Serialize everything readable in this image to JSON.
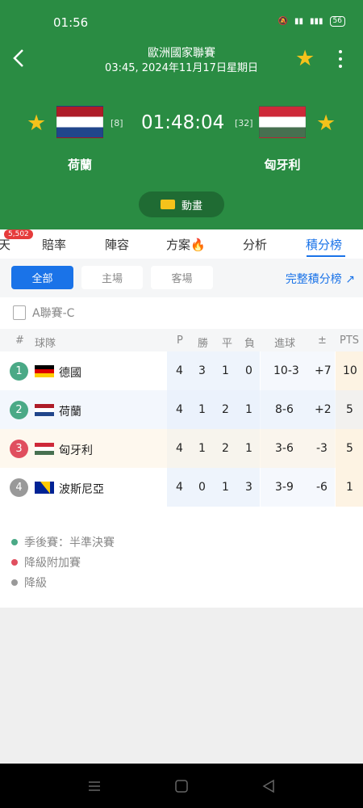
{
  "status": {
    "time": "01:56",
    "battery": "56"
  },
  "header": {
    "league": "歐洲國家聯賽",
    "datetime": "03:45, 2024年11月17日星期日",
    "score": "01:48:04",
    "home": {
      "name": "荷蘭",
      "rank": "[8]"
    },
    "away": {
      "name": "匈牙利",
      "rank": "[32]"
    },
    "animation_label": "動畫"
  },
  "tabs": {
    "badge": "5,502",
    "items": [
      {
        "label": "天"
      },
      {
        "label": "賠率"
      },
      {
        "label": "陣容"
      },
      {
        "label": "方案🔥"
      },
      {
        "label": "分析"
      },
      {
        "label": "積分榜"
      }
    ],
    "active": "積分榜"
  },
  "filters": {
    "all": "全部",
    "home": "主場",
    "away": "客場",
    "full_table": "完整積分榜 ↗"
  },
  "competition": "A聯賽-C",
  "table": {
    "headers": {
      "rank": "#",
      "team": "球隊",
      "p": "P",
      "w": "勝",
      "d": "平",
      "l": "負",
      "goals": "進球",
      "diff": "±",
      "pts": "PTS"
    },
    "rows": [
      {
        "pos": "1",
        "team": "德國",
        "p": "4",
        "w": "3",
        "d": "1",
        "l": "0",
        "goals": "10-3",
        "diff": "+7",
        "pts": "10",
        "color": "#4aa986"
      },
      {
        "pos": "2",
        "team": "荷蘭",
        "p": "4",
        "w": "1",
        "d": "2",
        "l": "1",
        "goals": "8-6",
        "diff": "+2",
        "pts": "5",
        "color": "#4aa986"
      },
      {
        "pos": "3",
        "team": "匈牙利",
        "p": "4",
        "w": "1",
        "d": "2",
        "l": "1",
        "goals": "3-6",
        "diff": "-3",
        "pts": "5",
        "color": "#e04f5f"
      },
      {
        "pos": "4",
        "team": "波斯尼亞",
        "p": "4",
        "w": "0",
        "d": "1",
        "l": "3",
        "goals": "3-9",
        "diff": "-6",
        "pts": "1",
        "color": "#999999"
      }
    ]
  },
  "legend": [
    {
      "label": "季後賽：半準決賽",
      "color": "#4aa986"
    },
    {
      "label": "降級附加賽",
      "color": "#e04f5f"
    },
    {
      "label": "降級",
      "color": "#999999"
    }
  ],
  "colors": {
    "header_bg": "#2a8c43",
    "accent": "#1a73e8",
    "star": "#f4c21b"
  }
}
